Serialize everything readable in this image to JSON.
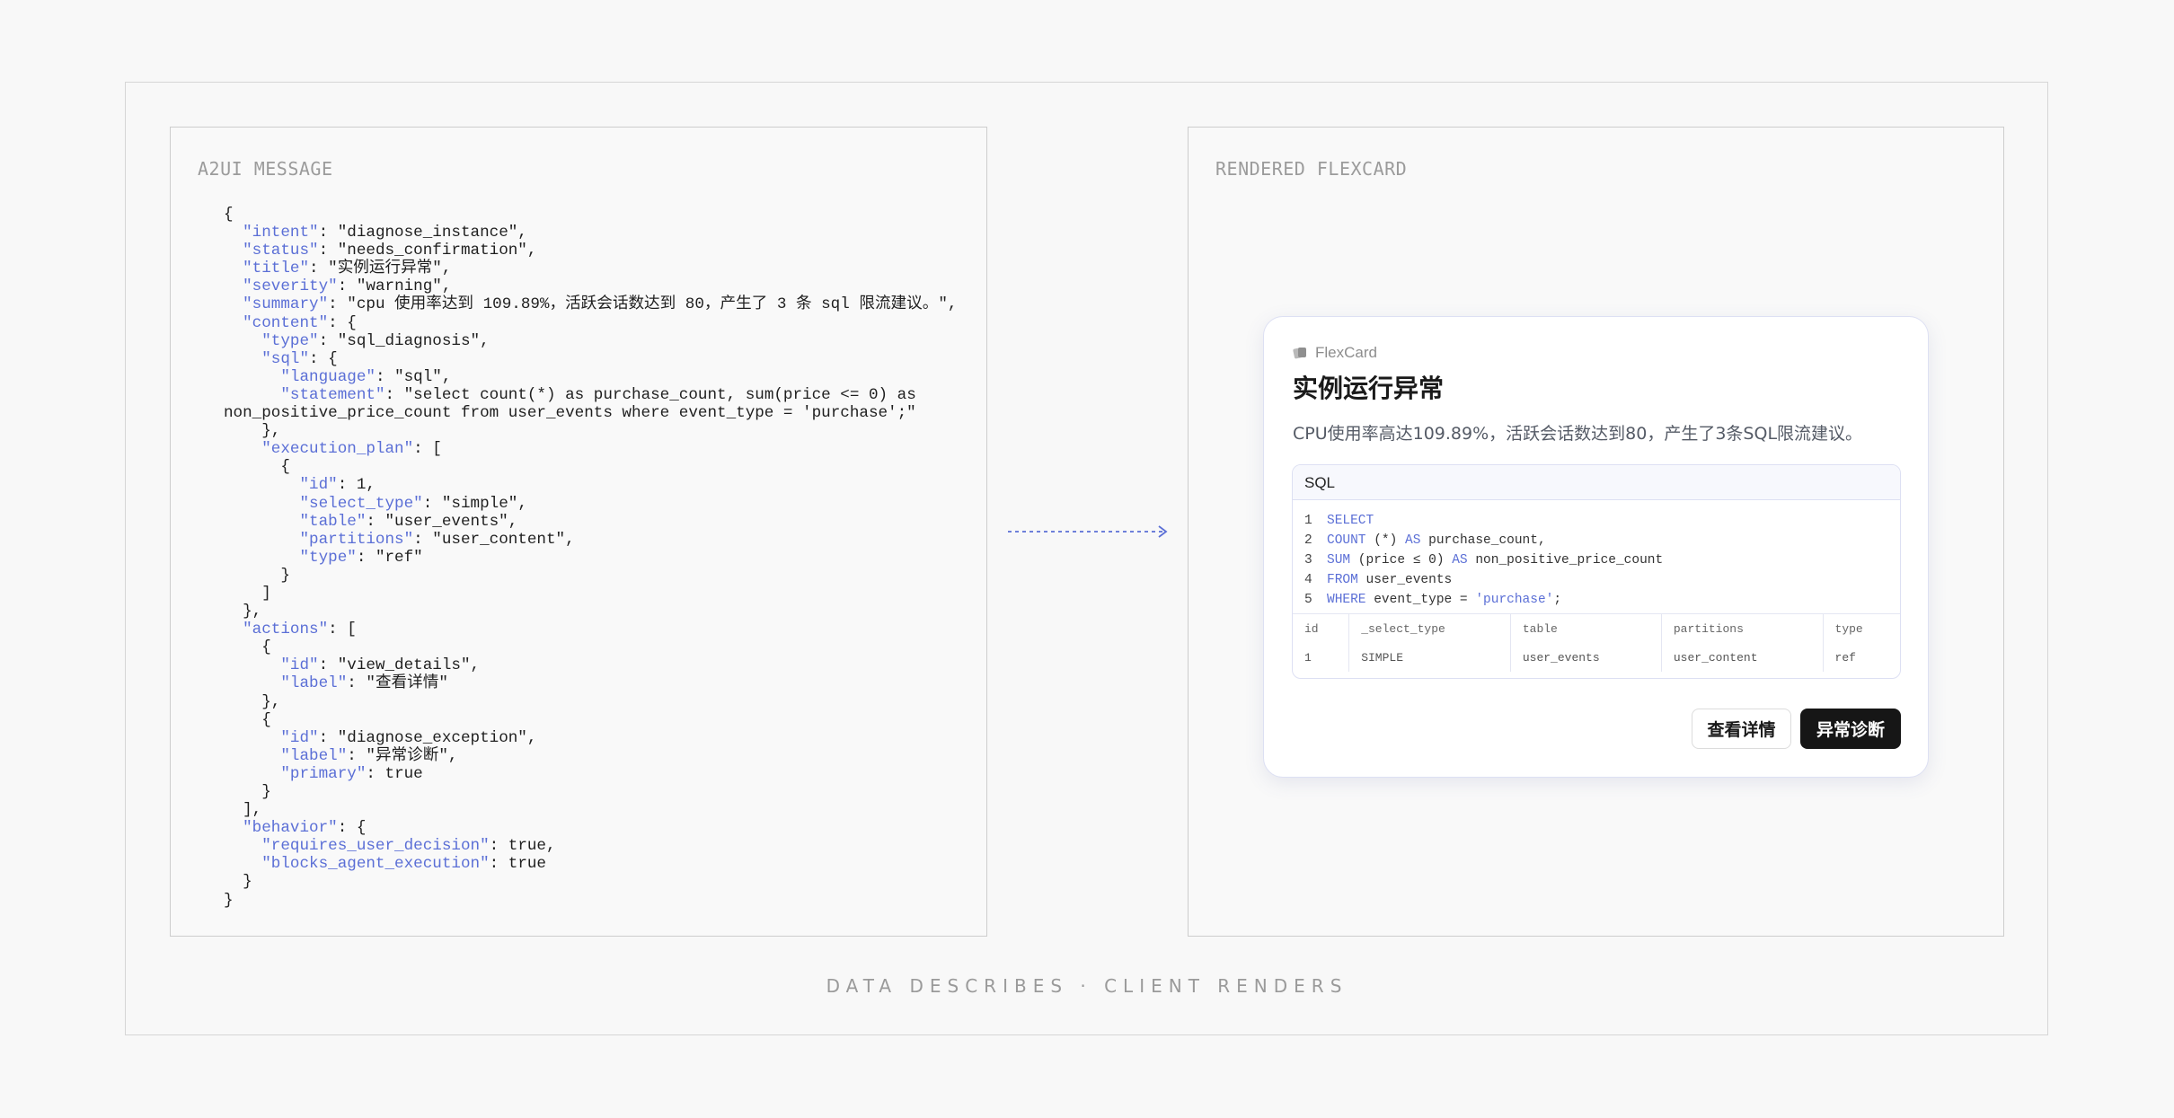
{
  "left_panel": {
    "label": "A2UI MESSAGE",
    "code_lines": [
      [
        {
          "t": "{"
        }
      ],
      [
        {
          "t": "  "
        },
        {
          "t": "\"intent\"",
          "k": 1
        },
        {
          "t": ": \"diagnose_instance\","
        }
      ],
      [
        {
          "t": "  "
        },
        {
          "t": "\"status\"",
          "k": 1
        },
        {
          "t": ": \"needs_confirmation\","
        }
      ],
      [
        {
          "t": "  "
        },
        {
          "t": "\"title\"",
          "k": 1
        },
        {
          "t": ": \"实例运行异常\","
        }
      ],
      [
        {
          "t": "  "
        },
        {
          "t": "\"severity\"",
          "k": 1
        },
        {
          "t": ": \"warning\","
        }
      ],
      [
        {
          "t": "  "
        },
        {
          "t": "\"summary\"",
          "k": 1
        },
        {
          "t": ": \"cpu 使用率达到 109.89%，活跃会话数达到 80，产生了 3 条 sql 限流建议。\","
        }
      ],
      [
        {
          "t": "  "
        },
        {
          "t": "\"content\"",
          "k": 1
        },
        {
          "t": ": {"
        }
      ],
      [
        {
          "t": "    "
        },
        {
          "t": "\"type\"",
          "k": 1
        },
        {
          "t": ": \"sql_diagnosis\","
        }
      ],
      [
        {
          "t": "    "
        },
        {
          "t": "\"sql\"",
          "k": 1
        },
        {
          "t": ": {"
        }
      ],
      [
        {
          "t": "      "
        },
        {
          "t": "\"language\"",
          "k": 1
        },
        {
          "t": ": \"sql\","
        }
      ],
      [
        {
          "t": "      "
        },
        {
          "t": "\"statement\"",
          "k": 1
        },
        {
          "t": ": \"select count(*) as purchase_count, sum(price <= 0) as"
        }
      ],
      [
        {
          "t": "non_positive_price_count from user_events where event_type = 'purchase';\""
        }
      ],
      [
        {
          "t": "    },"
        }
      ],
      [
        {
          "t": "    "
        },
        {
          "t": "\"execution_plan\"",
          "k": 1
        },
        {
          "t": ": ["
        }
      ],
      [
        {
          "t": "      {"
        }
      ],
      [
        {
          "t": "        "
        },
        {
          "t": "\"id\"",
          "k": 1
        },
        {
          "t": ": 1,"
        }
      ],
      [
        {
          "t": "        "
        },
        {
          "t": "\"select_type\"",
          "k": 1
        },
        {
          "t": ": \"simple\","
        }
      ],
      [
        {
          "t": "        "
        },
        {
          "t": "\"table\"",
          "k": 1
        },
        {
          "t": ": \"user_events\","
        }
      ],
      [
        {
          "t": "        "
        },
        {
          "t": "\"partitions\"",
          "k": 1
        },
        {
          "t": ": \"user_content\","
        }
      ],
      [
        {
          "t": "        "
        },
        {
          "t": "\"type\"",
          "k": 1
        },
        {
          "t": ": \"ref\""
        }
      ],
      [
        {
          "t": "      }"
        }
      ],
      [
        {
          "t": "    ]"
        }
      ],
      [
        {
          "t": "  },"
        }
      ],
      [
        {
          "t": "  "
        },
        {
          "t": "\"actions\"",
          "k": 1
        },
        {
          "t": ": ["
        }
      ],
      [
        {
          "t": "    {"
        }
      ],
      [
        {
          "t": "      "
        },
        {
          "t": "\"id\"",
          "k": 1
        },
        {
          "t": ": \"view_details\","
        }
      ],
      [
        {
          "t": "      "
        },
        {
          "t": "\"label\"",
          "k": 1
        },
        {
          "t": ": \"查看详情\""
        }
      ],
      [
        {
          "t": "    },"
        }
      ],
      [
        {
          "t": "    {"
        }
      ],
      [
        {
          "t": "      "
        },
        {
          "t": "\"id\"",
          "k": 1
        },
        {
          "t": ": \"diagnose_exception\","
        }
      ],
      [
        {
          "t": "      "
        },
        {
          "t": "\"label\"",
          "k": 1
        },
        {
          "t": ": \"异常诊断\","
        }
      ],
      [
        {
          "t": "      "
        },
        {
          "t": "\"primary\"",
          "k": 1
        },
        {
          "t": ": true"
        }
      ],
      [
        {
          "t": "    }"
        }
      ],
      [
        {
          "t": "  ],"
        }
      ],
      [
        {
          "t": "  "
        },
        {
          "t": "\"behavior\"",
          "k": 1
        },
        {
          "t": ": {"
        }
      ],
      [
        {
          "t": "    "
        },
        {
          "t": "\"requires_user_decision\"",
          "k": 1
        },
        {
          "t": ": true,"
        }
      ],
      [
        {
          "t": "    "
        },
        {
          "t": "\"blocks_agent_execution\"",
          "k": 1
        },
        {
          "t": ": true"
        }
      ],
      [
        {
          "t": "  }"
        }
      ],
      [
        {
          "t": "}"
        }
      ]
    ]
  },
  "right_panel": {
    "label": "RENDERED FLEXCARD",
    "card": {
      "brand": "FlexCard",
      "title": "实例运行异常",
      "summary": "CPU使用率高达109.89%，活跃会话数达到80，产生了3条SQL限流建议。",
      "sql_header": "SQL",
      "sql_lines": [
        {
          "n": "1",
          "parts": [
            {
              "t": "SELECT",
              "c": "kw"
            }
          ]
        },
        {
          "n": "2",
          "parts": [
            {
              "t": "COUNT",
              "c": "kw"
            },
            {
              "t": " (*) "
            },
            {
              "t": "AS",
              "c": "kw"
            },
            {
              "t": " purchase_count,"
            }
          ]
        },
        {
          "n": "3",
          "parts": [
            {
              "t": "SUM",
              "c": "kw"
            },
            {
              "t": " (price ≤ 0) "
            },
            {
              "t": "AS",
              "c": "kw"
            },
            {
              "t": " non_positive_price_count"
            }
          ]
        },
        {
          "n": "4",
          "parts": [
            {
              "t": "FROM",
              "c": "kw"
            },
            {
              "t": " user_events"
            }
          ]
        },
        {
          "n": "5",
          "parts": [
            {
              "t": "WHERE",
              "c": "kw"
            },
            {
              "t": " event_type = "
            },
            {
              "t": "'purchase'",
              "c": "str"
            },
            {
              "t": ";"
            }
          ]
        }
      ],
      "plan_columns": [
        "id",
        "_select_type",
        "table",
        "partitions",
        "type"
      ],
      "plan_rows": [
        [
          "1",
          "SIMPLE",
          "user_events",
          "user_content",
          "ref"
        ]
      ],
      "secondary_button": "查看详情",
      "primary_button": "异常诊断"
    }
  },
  "caption": "DATA DESCRIBES · CLIENT RENDERS",
  "colors": {
    "key": "#5b6fd6",
    "arrow": "#5b6fd6",
    "primary_button_bg": "#161616",
    "card_border": "#dde0f3"
  },
  "icons": {
    "brand": "flexcard-logo-icon",
    "arrow": "arrow-right-icon"
  }
}
